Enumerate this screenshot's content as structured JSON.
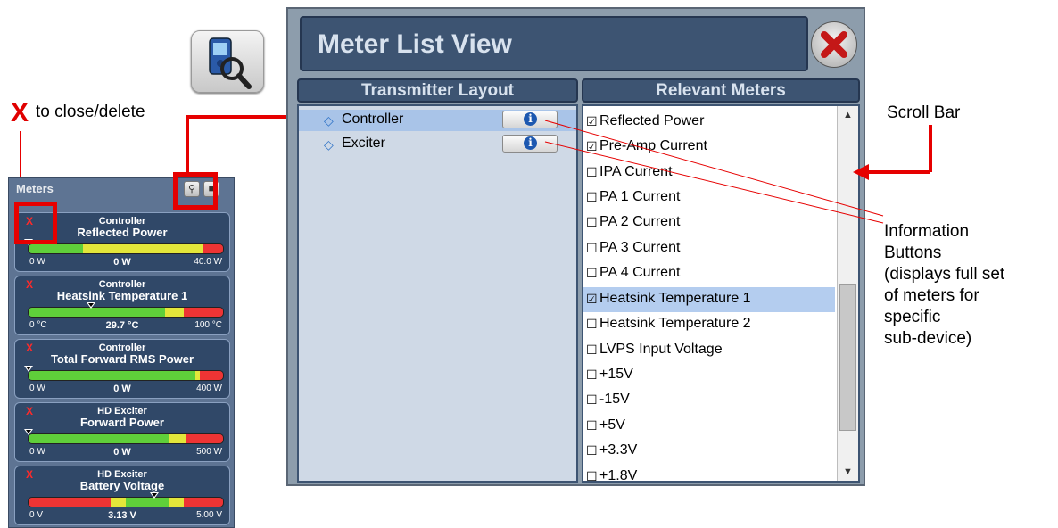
{
  "annotations": {
    "close_delete": {
      "x_mark": "X",
      "text": "to close/delete"
    },
    "scroll_bar": "Scroll Bar",
    "info_buttons": [
      "Information",
      "Buttons",
      "(displays full set",
      "of meters for",
      "specific",
      "sub-device)"
    ]
  },
  "meters_panel": {
    "title": "Meters",
    "meters": [
      {
        "source": "Controller",
        "name": "Reflected Power",
        "low": "0 W",
        "value": "0 W",
        "high": "40.0 W",
        "needle": 0.0
      },
      {
        "source": "Controller",
        "name": "Heatsink Temperature 1",
        "low": "0 °C",
        "value": "29.7 °C",
        "high": "100 °C",
        "needle": 0.3
      },
      {
        "source": "Controller",
        "name": "Total Forward RMS Power",
        "low": "0 W",
        "value": "0 W",
        "high": "400 W",
        "needle": 0.0
      },
      {
        "source": "HD Exciter",
        "name": "Forward Power",
        "low": "0 W",
        "value": "0 W",
        "high": "500 W",
        "needle": 0.0
      },
      {
        "source": "HD Exciter",
        "name": "Battery Voltage",
        "low": "0 V",
        "value": "3.13 V",
        "high": "5.00 V",
        "needle": 0.63
      }
    ],
    "delete_mark": "X"
  },
  "meter_list_view": {
    "title": "Meter List View",
    "transmitter_layout": {
      "header": "Transmitter Layout",
      "items": [
        {
          "label": "Controller",
          "selected": true
        },
        {
          "label": "Exciter",
          "selected": false
        }
      ],
      "info_glyph": "i"
    },
    "relevant_meters": {
      "header": "Relevant Meters",
      "items": [
        {
          "label": "Reflected Power",
          "checked": true,
          "selected": false
        },
        {
          "label": "Pre-Amp Current",
          "checked": true,
          "selected": false
        },
        {
          "label": "IPA Current",
          "checked": false,
          "selected": false
        },
        {
          "label": "PA 1 Current",
          "checked": false,
          "selected": false
        },
        {
          "label": "PA 2 Current",
          "checked": false,
          "selected": false
        },
        {
          "label": "PA 3 Current",
          "checked": false,
          "selected": false
        },
        {
          "label": "PA 4 Current",
          "checked": false,
          "selected": false
        },
        {
          "label": "Heatsink Temperature 1",
          "checked": true,
          "selected": true
        },
        {
          "label": "Heatsink Temperature 2",
          "checked": false,
          "selected": false
        },
        {
          "label": "LVPS Input Voltage",
          "checked": false,
          "selected": false
        },
        {
          "label": "+15V",
          "checked": false,
          "selected": false
        },
        {
          "label": "-15V",
          "checked": false,
          "selected": false
        },
        {
          "label": "+5V",
          "checked": false,
          "selected": false
        },
        {
          "label": "+3.3V",
          "checked": false,
          "selected": false
        },
        {
          "label": "+1.8V",
          "checked": false,
          "selected": false
        }
      ],
      "scroll_up": "▲",
      "scroll_down": "▼"
    }
  },
  "colors": {
    "callout_red": "#e60000",
    "panel_navy": "#3d5472",
    "selection_blue": "#b4cdef"
  }
}
